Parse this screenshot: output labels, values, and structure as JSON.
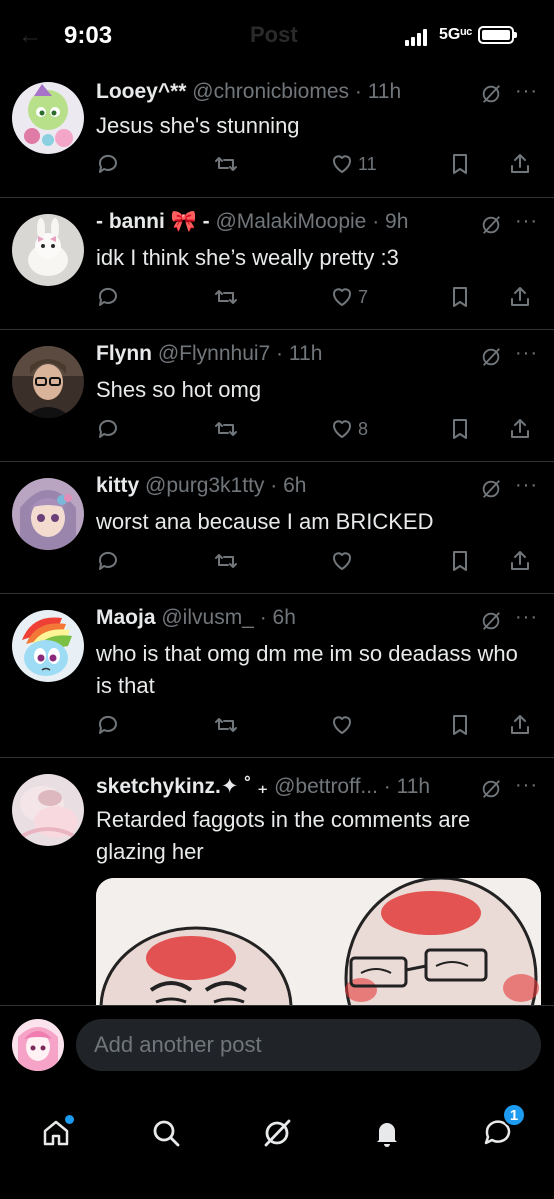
{
  "status_bar": {
    "time": "9:03",
    "network": "5Gᵘᶜ",
    "behind_back": "←",
    "behind_title": "Post"
  },
  "replies": [
    {
      "name": "Looey^**",
      "handle": "@chronicbiomes",
      "time": "11h",
      "text": "Jesus she's stunning",
      "likes": "11"
    },
    {
      "name": "- banni 🎀 -",
      "handle": "@MalakiMoopie",
      "time": "9h",
      "text": "idk I think she’s weally pretty :3",
      "likes": "7"
    },
    {
      "name": "Flynn",
      "handle": "@Flynnhui7",
      "time": "11h",
      "text": "Shes so hot omg",
      "likes": "8"
    },
    {
      "name": "kitty",
      "handle": "@purg3k1tty",
      "time": "6h",
      "text": "worst ana because I am BRICKED",
      "likes": ""
    },
    {
      "name": "Maoja",
      "handle": "@ilvusm_",
      "time": "6h",
      "text": "who is that omg dm me im so deadass who is that",
      "likes": ""
    },
    {
      "name": "sketchykinz.✦ ˚ ₊",
      "handle": "@bettroff...",
      "time": "11h",
      "text": "Retarded faggots in the comments are glazing her",
      "likes": ""
    }
  ],
  "composer": {
    "placeholder": "Add another post"
  },
  "bottom_nav": {
    "messages_badge": "1"
  },
  "icons": {
    "reply": "speech-bubble-icon",
    "repost": "repost-arrows-icon",
    "like": "heart-icon",
    "bookmark": "bookmark-icon",
    "share": "share-upload-icon",
    "grok": "grok-icon",
    "more": "more-dots-icon"
  },
  "colors": {
    "background": "#000000",
    "text": "#e7e9ea",
    "muted": "#71767b",
    "divider": "#2f3336",
    "accent": "#1d9bf0"
  }
}
